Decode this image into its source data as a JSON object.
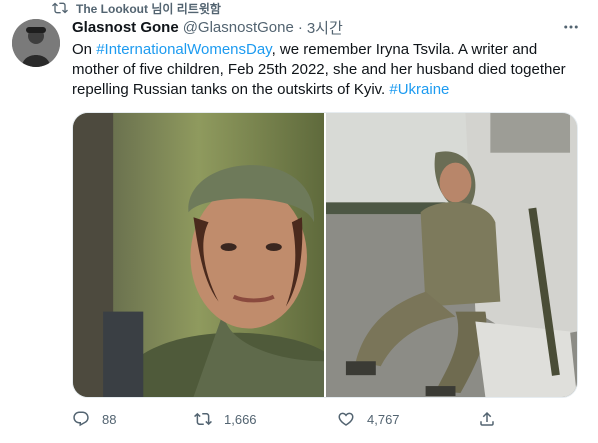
{
  "retweet": {
    "label": "The Lookout 님이 리트윗함"
  },
  "tweet": {
    "display_name": "Glasnost Gone",
    "handle": "@GlasnostGone",
    "dot": "·",
    "time": "3시간",
    "text": {
      "p1": "On ",
      "hashtag1": "#InternationalWomensDay",
      "p2": ", we remember Iryna Tsvila. A writer and mother of five children, Feb 25th 2022, she and her husband died together repelling Russian tanks on the outskirts of Kyiv. ",
      "hashtag2": "#Ukraine"
    }
  },
  "actions": {
    "reply_count": "88",
    "retweet_count": "1,666",
    "like_count": "4,767"
  },
  "icons": {
    "retweet": "retweet-icon",
    "more": "more-icon",
    "reply": "reply-icon",
    "like": "heart-icon",
    "share": "share-icon"
  },
  "colors": {
    "link": "#1d9bf0",
    "secondary_text": "#536471",
    "primary_text": "#0f1419"
  }
}
